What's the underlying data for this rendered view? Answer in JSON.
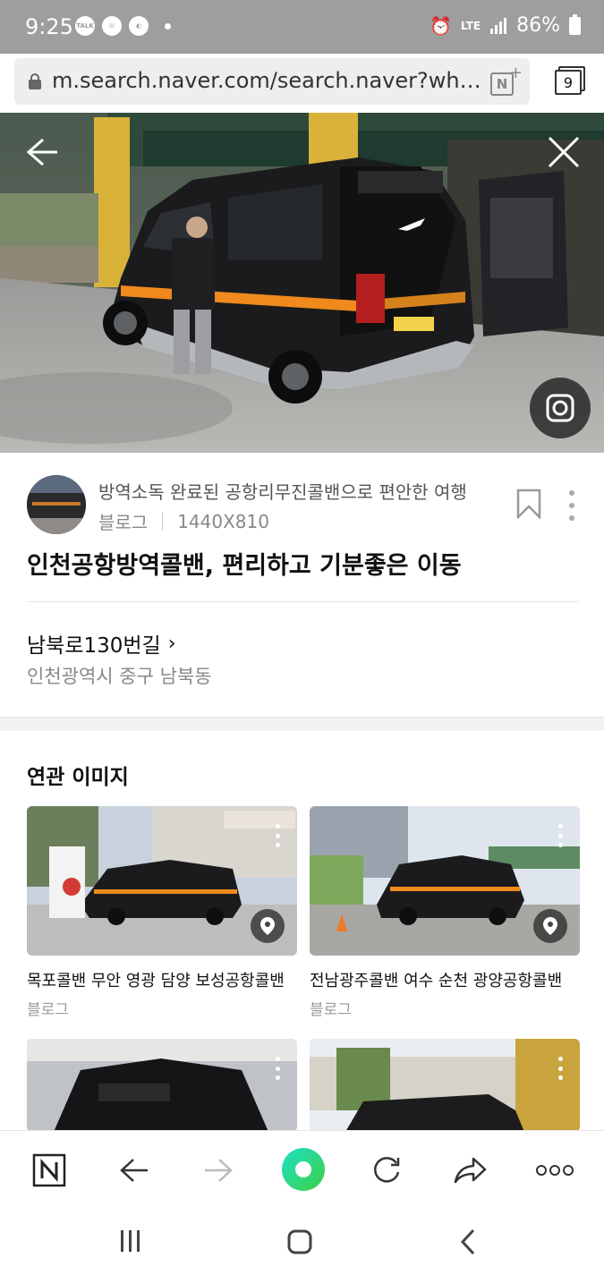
{
  "status_bar": {
    "time": "9:25",
    "icons": [
      "talk-icon",
      "call-icon",
      "data-saver-icon",
      "dot-icon"
    ],
    "network": "LTE",
    "battery": "86%"
  },
  "browser": {
    "url": "m.search.naver.com/search.naver?where=image",
    "tab_count": "9"
  },
  "image_viewer": {
    "back_icon": "arrow-left-icon",
    "close_icon": "close-icon",
    "lens_icon": "camera-lens-icon"
  },
  "result": {
    "source_title": "방역소독 완료된 공항리무진콜밴으로 편안한 여행",
    "source_type": "블로그",
    "image_size": "1440X810",
    "title": "인천공항방역콜밴, 편리하고 기분좋은 이동",
    "address_main": "남북로130번길",
    "address_sub": "인천광역시 중구 남북동"
  },
  "related": {
    "heading": "연관 이미지",
    "cards": [
      {
        "caption": "목포콜밴 무안 영광 담양 보성공항콜밴",
        "source": "블로그"
      },
      {
        "caption": "전남광주콜밴 여수 순천 광양공항콜밴",
        "source": "블로그"
      },
      {
        "caption": "",
        "source": ""
      },
      {
        "caption": "",
        "source": ""
      }
    ]
  },
  "toolbar": {
    "items": [
      "naver-home-icon",
      "back-arrow-icon",
      "forward-arrow-icon",
      "green-dot-icon",
      "refresh-icon",
      "share-icon",
      "more-icon"
    ]
  },
  "colors": {
    "status_bar": "#9e9e9e",
    "accent_green": "#2ed46a",
    "van": "#1a1a1a",
    "stripe": "#f08a1c"
  }
}
